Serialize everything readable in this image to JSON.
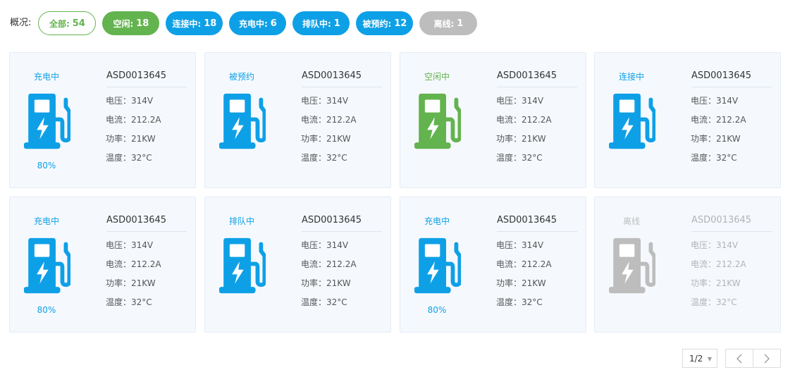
{
  "filter": {
    "label": "概况:",
    "pills": [
      {
        "label": "全部:",
        "count": "54"
      },
      {
        "label": "空闲:",
        "count": "18"
      },
      {
        "label": "连接中:",
        "count": "18"
      },
      {
        "label": "充电中:",
        "count": "6"
      },
      {
        "label": "排队中:",
        "count": "1"
      },
      {
        "label": "被预约:",
        "count": "12"
      },
      {
        "label": "离线:",
        "count": "1"
      }
    ]
  },
  "colors": {
    "charging": "#0ea0e6",
    "idle": "#63b34e",
    "offline": "#bdbdbd"
  },
  "cards": [
    {
      "status": "充电中",
      "percent": "80%",
      "id": "ASD0013645",
      "voltage": "电压：314V",
      "current": "电流：212.2A",
      "power": "功率：21KW",
      "temp": "温度：32°C",
      "icon": "charging-station-icon"
    },
    {
      "status": "被预约",
      "percent": "",
      "id": "ASD0013645",
      "voltage": "电压：314V",
      "current": "电流：212.2A",
      "power": "功率：21KW",
      "temp": "温度：32°C",
      "icon": "charging-station-icon"
    },
    {
      "status": "空闲中",
      "percent": "",
      "id": "ASD0013645",
      "voltage": "电压：314V",
      "current": "电流：212.2A",
      "power": "功率：21KW",
      "temp": "温度：32°C",
      "icon": "charging-station-icon"
    },
    {
      "status": "连接中",
      "percent": "",
      "id": "ASD0013645",
      "voltage": "电压：314V",
      "current": "电流：212.2A",
      "power": "功率：21KW",
      "temp": "温度：32°C",
      "icon": "charging-station-icon"
    },
    {
      "status": "充电中",
      "percent": "80%",
      "id": "ASD0013645",
      "voltage": "电压：314V",
      "current": "电流：212.2A",
      "power": "功率：21KW",
      "temp": "温度：32°C",
      "icon": "charging-station-icon"
    },
    {
      "status": "排队中",
      "percent": "",
      "id": "ASD0013645",
      "voltage": "电压：314V",
      "current": "电流：212.2A",
      "power": "功率：21KW",
      "temp": "温度：32°C",
      "icon": "charging-station-icon"
    },
    {
      "status": "充电中",
      "percent": "80%",
      "id": "ASD0013645",
      "voltage": "电压：314V",
      "current": "电流：212.2A",
      "power": "功率：21KW",
      "temp": "温度：32°C",
      "icon": "charging-station-icon"
    },
    {
      "status": "离线",
      "percent": "",
      "id": "ASD0013645",
      "voltage": "电压：314V",
      "current": "电流：212.2A",
      "power": "功率：21KW",
      "temp": "温度：32°C",
      "icon": "charging-station-icon"
    }
  ],
  "pagination": {
    "page": "1/2"
  }
}
